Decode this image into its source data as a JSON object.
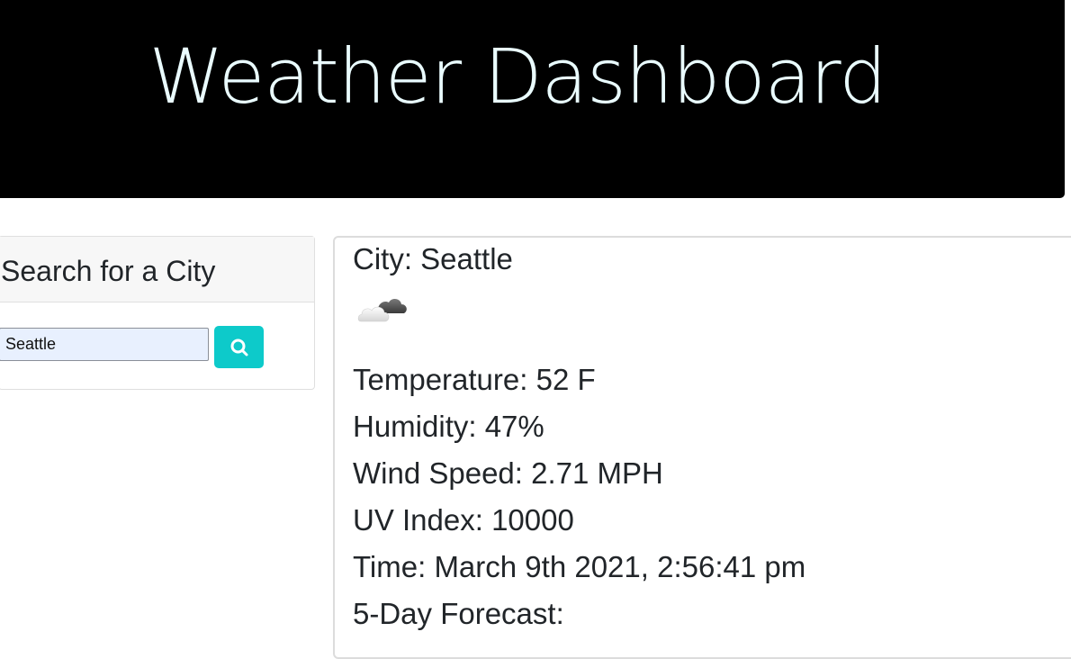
{
  "header": {
    "title": "Weather Dashboard"
  },
  "search": {
    "heading": "Search for a City",
    "input_value": "Seattle",
    "button_icon": "search-icon",
    "button_color": "#0dcaca"
  },
  "current": {
    "city_line": "City: Seattle",
    "icon": "partly-cloudy-icon",
    "temperature_line": "Temperature: 52 F",
    "humidity_line": "Humidity: 47%",
    "wind_line": "Wind Speed: 2.71 MPH",
    "uv_line": "UV Index: 10000",
    "time_line": "Time: March 9th 2021, 2:56:41 pm",
    "forecast_heading": "5-Day Forecast:"
  }
}
